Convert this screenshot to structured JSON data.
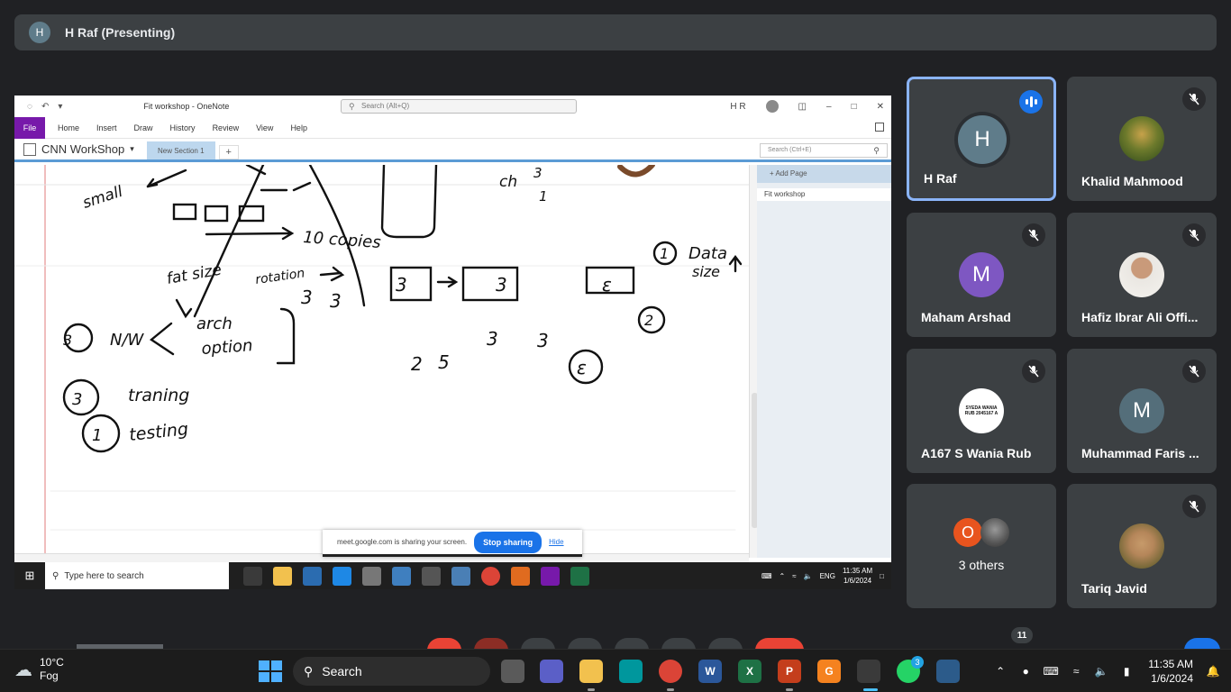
{
  "presenter": {
    "initial": "H",
    "label": "H Raf (Presenting)"
  },
  "onenote": {
    "title": "Fit workshop - OneNote",
    "search_placeholder": "Search (Alt+Q)",
    "user_initials": "H R",
    "menu": [
      "File",
      "Home",
      "Insert",
      "Draw",
      "History",
      "Review",
      "View",
      "Help"
    ],
    "notebook": "CNN WorkShop",
    "section_tab": "New Section 1",
    "add_tab": "+",
    "page_search": "Search (Ctrl+E)",
    "add_page": "Add Page",
    "page": "Fit workshop"
  },
  "share_banner": {
    "message": "meet.google.com is sharing your screen.",
    "stop": "Stop sharing",
    "hide": "Hide"
  },
  "inner_taskbar": {
    "search": "Type here to search",
    "lang": "ENG",
    "time": "11:35 AM",
    "date": "1/6/2024"
  },
  "participants": [
    {
      "name": "H Raf",
      "initial": "H",
      "color": "#5f7c8a",
      "speaking": true
    },
    {
      "name": "Khalid Mahmood",
      "photo": true
    },
    {
      "name": "Maham Arshad",
      "initial": "M",
      "color": "#7e57c2"
    },
    {
      "name": "Hafiz Ibrar Ali Offi...",
      "photo": true
    },
    {
      "name": "A167 S Wania Rub",
      "logo_text": "SYEDA WANIA RUB 2045167 A"
    },
    {
      "name": "Muhammad Faris ...",
      "initial": "M",
      "color": "#546e7a"
    },
    {
      "name": "3 others",
      "initial": "O",
      "color": "#e8541e"
    },
    {
      "name": "Tariq Javid",
      "photo": true
    }
  ],
  "meet_count": "11",
  "taskbar": {
    "weather_temp": "10°C",
    "weather_desc": "Fog",
    "search": "Search",
    "time": "11:35 AM",
    "date": "1/6/2024",
    "whatsapp_badge": "3"
  },
  "sketch": {
    "words": [
      "small",
      "10 copies",
      "fat size",
      "rotation",
      "N/W",
      "arch",
      "option",
      "traning",
      "testing",
      "ch",
      "Data",
      "size",
      "3",
      "2",
      "1",
      "5",
      "ε"
    ]
  }
}
